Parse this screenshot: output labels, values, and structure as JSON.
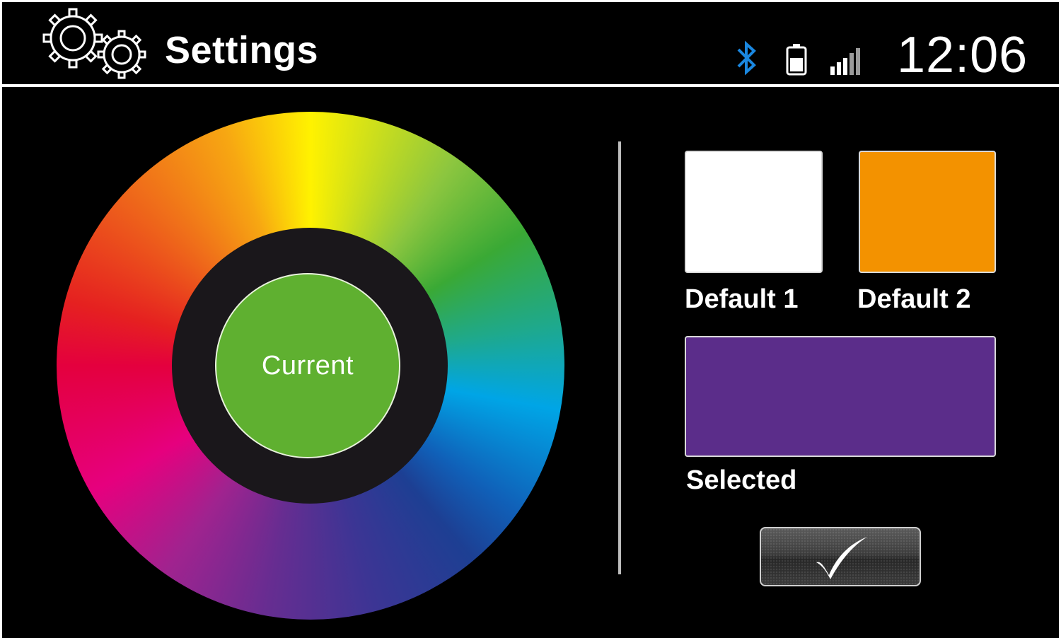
{
  "header": {
    "title": "Settings",
    "time": "12:06",
    "icons": {
      "settings": "gears-icon",
      "bluetooth": "bluetooth-icon",
      "battery": "battery-icon",
      "signal": "signal-strength-icon"
    },
    "bluetooth_color": "#1a87e0"
  },
  "color_wheel": {
    "current_label": "Current",
    "current_color": "#5fb030",
    "hub_color": "#1a171b"
  },
  "presets": {
    "default1": {
      "label": "Default 1",
      "color": "#ffffff"
    },
    "default2": {
      "label": "Default 2",
      "color": "#f39200"
    },
    "selected": {
      "label": "Selected",
      "color": "#5b2d8a"
    }
  },
  "confirm": {
    "icon": "checkmark-icon"
  }
}
